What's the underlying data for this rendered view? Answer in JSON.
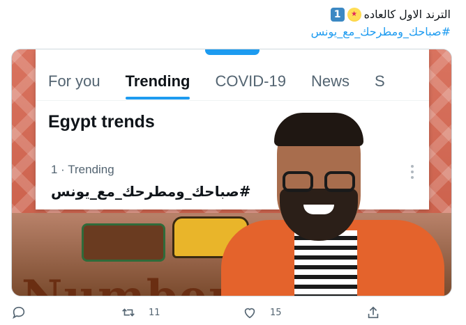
{
  "tweet": {
    "top_cut_text": "...",
    "line1_text": "الترند الاول كالعاده",
    "keycap_text": "1",
    "star_emoji": "star-struck",
    "hashtag": "#صباحك_ومطرحك_مع_يونس"
  },
  "media": {
    "tabs": [
      "For you",
      "Trending",
      "COVID-19",
      "News",
      "S"
    ],
    "active_tab": "Trending",
    "card_title": "Egypt trends",
    "trend_meta": "1 · Trending",
    "trend_tag": "#صباحك_ومطرحك_مع_يونس",
    "background_word": "Number"
  },
  "actions": {
    "reply_count": "",
    "retweet_count": "11",
    "like_count": "15"
  },
  "colors": {
    "accent": "#1d9bf0",
    "text_secondary": "#536471",
    "jacket": "#e4632c"
  }
}
